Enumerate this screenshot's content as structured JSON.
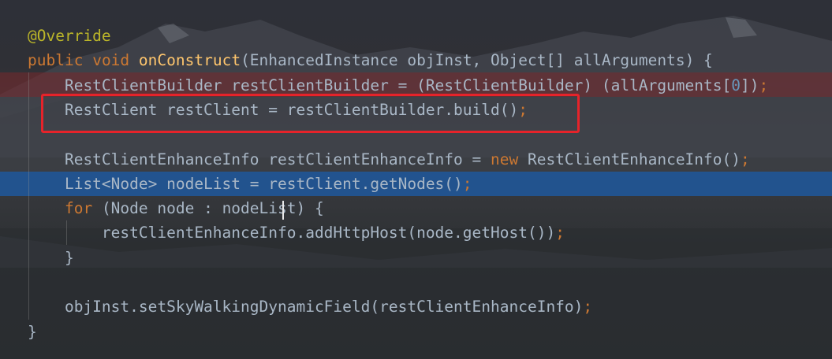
{
  "editor": {
    "theme_colors": {
      "annotation": "#bbb529",
      "keyword": "#cc7832",
      "method_declaration": "#ffc66d",
      "number": "#6897bb",
      "text": "#a9b7c6",
      "error_line_highlight": "#78282c",
      "selected_line_highlight": "#215696",
      "annotation_box": "#e6232a"
    },
    "lines": [
      {
        "tokens": [
          {
            "t": "@Override",
            "c": "ann"
          }
        ]
      },
      {
        "tokens": [
          {
            "t": "public",
            "c": "kw"
          },
          {
            "t": " ",
            "c": "txt"
          },
          {
            "t": "void",
            "c": "kw"
          },
          {
            "t": " ",
            "c": "txt"
          },
          {
            "t": "onConstruct",
            "c": "fn"
          },
          {
            "t": "(EnhancedInstance objInst, Object[] allArguments) {",
            "c": "txt"
          }
        ]
      },
      {
        "tokens": [
          {
            "t": "    RestClientBuilder restClientBuilder = (RestClientBuilder) (allArguments[",
            "c": "txt"
          },
          {
            "t": "0",
            "c": "num"
          },
          {
            "t": "])",
            "c": "txt"
          },
          {
            "t": ";",
            "c": "kw"
          }
        ]
      },
      {
        "tokens": [
          {
            "t": "    RestClient restClient = restClientBuilder.build()",
            "c": "txt"
          },
          {
            "t": ";",
            "c": "kw"
          }
        ]
      },
      {
        "tokens": []
      },
      {
        "tokens": [
          {
            "t": "    RestClientEnhanceInfo restClientEnhanceInfo = ",
            "c": "txt"
          },
          {
            "t": "new",
            "c": "kw"
          },
          {
            "t": " RestClientEnhanceInfo()",
            "c": "txt"
          },
          {
            "t": ";",
            "c": "kw"
          }
        ]
      },
      {
        "tokens": [
          {
            "t": "    List<Node> nodeList = restClient.getNodes()",
            "c": "txt"
          },
          {
            "t": ";",
            "c": "kw"
          }
        ]
      },
      {
        "tokens": [
          {
            "t": "    ",
            "c": "txt"
          },
          {
            "t": "for",
            "c": "kw"
          },
          {
            "t": " (Node node : nodeList) {",
            "c": "txt"
          }
        ]
      },
      {
        "tokens": [
          {
            "t": "        restClientEnhanceInfo.addHttpHost(node.getHost())",
            "c": "txt"
          },
          {
            "t": ";",
            "c": "kw"
          }
        ]
      },
      {
        "tokens": [
          {
            "t": "    }",
            "c": "txt"
          }
        ]
      },
      {
        "tokens": []
      },
      {
        "tokens": [
          {
            "t": "    objInst.setSkyWalkingDynamicField(restClientEnhanceInfo)",
            "c": "txt"
          },
          {
            "t": ";",
            "c": "kw"
          }
        ]
      },
      {
        "tokens": [
          {
            "t": "}",
            "c": "txt"
          }
        ]
      }
    ]
  }
}
